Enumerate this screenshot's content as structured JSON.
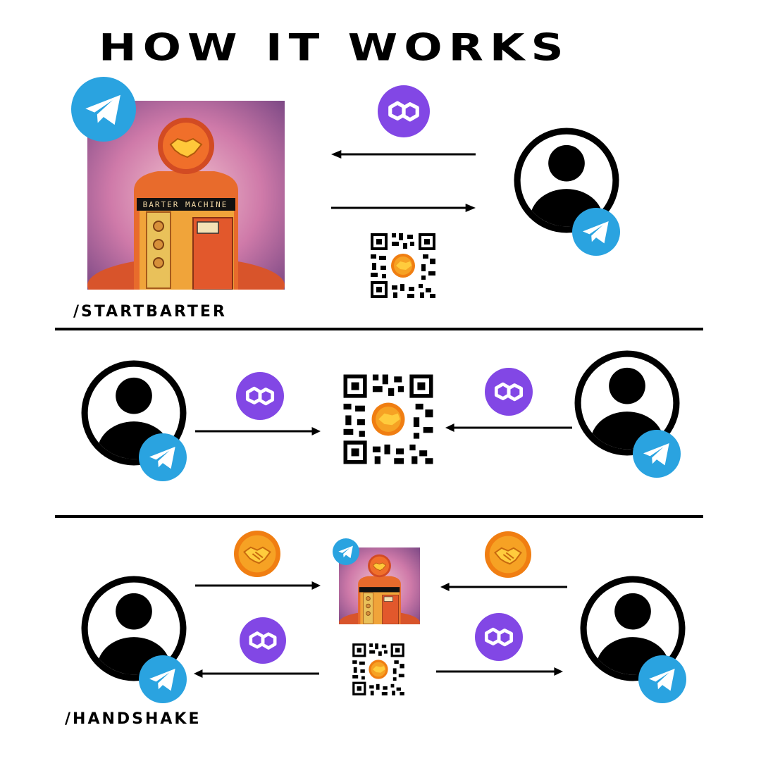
{
  "title": "HOW IT WORKS",
  "machine_label": "BARTER MACHINE",
  "commands": {
    "start": "/STARTBARTER",
    "handshake": "/HANDSHAKE"
  },
  "colors": {
    "telegram": "#2aa3e0",
    "polygon": "#8247e5",
    "handshake": "#f59a1b",
    "ink": "#000000"
  },
  "icons": [
    "telegram-icon",
    "polygon-icon",
    "handshake-icon",
    "user-icon",
    "qr-code-icon",
    "arrow-icon"
  ]
}
